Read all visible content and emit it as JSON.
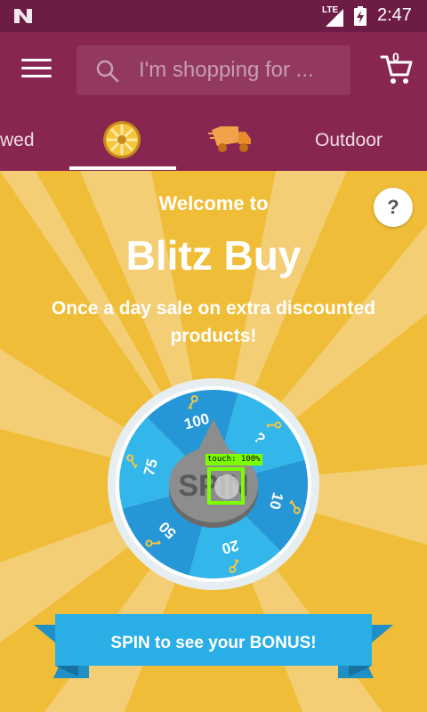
{
  "status_bar": {
    "network": "LTE",
    "time": "2:47"
  },
  "app_bar": {
    "search_placeholder": "I'm shopping for ...",
    "cart_count": "0"
  },
  "tabs": [
    {
      "label": "wed",
      "icon": null,
      "selected": false
    },
    {
      "label": "",
      "icon": "blitz-wheel-icon",
      "selected": true
    },
    {
      "label": "",
      "icon": "delivery-truck-icon",
      "selected": false
    },
    {
      "label": "Outdoor",
      "icon": null,
      "selected": false
    }
  ],
  "main": {
    "welcome": "Welcome to",
    "title": "Blitz Buy",
    "subtitle": "Once a day sale on extra discounted products!",
    "help_label": "?",
    "wheel": {
      "segments": [
        "?",
        "10",
        "20",
        "50",
        "75",
        "100"
      ],
      "spin_label": "SPIN"
    },
    "banner_text": "SPIN to see your BONUS!"
  },
  "overlay": {
    "touch_label": "touch: 100%"
  },
  "colors": {
    "status_bar": "#6d1d45",
    "app_bar": "#872650",
    "background": "#efbd37",
    "ray_light": "#f5d48a",
    "wheel_blue_light": "#33b6e9",
    "wheel_blue_dark": "#2596d6",
    "banner": "#2aaee6",
    "touch_box": "#7cff00"
  }
}
